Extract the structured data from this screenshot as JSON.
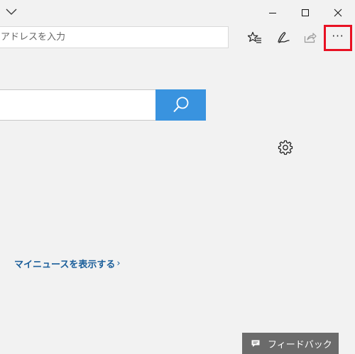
{
  "titlebar": {
    "tab_dropdown_icon": "chevron-down-icon",
    "minimize_icon": "minimize-icon",
    "maximize_icon": "maximize-icon",
    "close_icon": "close-icon"
  },
  "toolbar": {
    "address_placeholder": "アドレスを入力",
    "favorites_icon": "star-list-icon",
    "notes_icon": "pen-icon",
    "share_icon": "share-icon",
    "more_label": "···",
    "more_highlight_color": "#e81123"
  },
  "content": {
    "search_button_color": "#3993df",
    "search_icon": "search-icon",
    "settings_icon": "gear-icon",
    "news_link_label": "マイニュースを表示する",
    "news_link_chevron": "›",
    "feedback_label": "フィードバック",
    "feedback_icon": "comment-icon"
  }
}
